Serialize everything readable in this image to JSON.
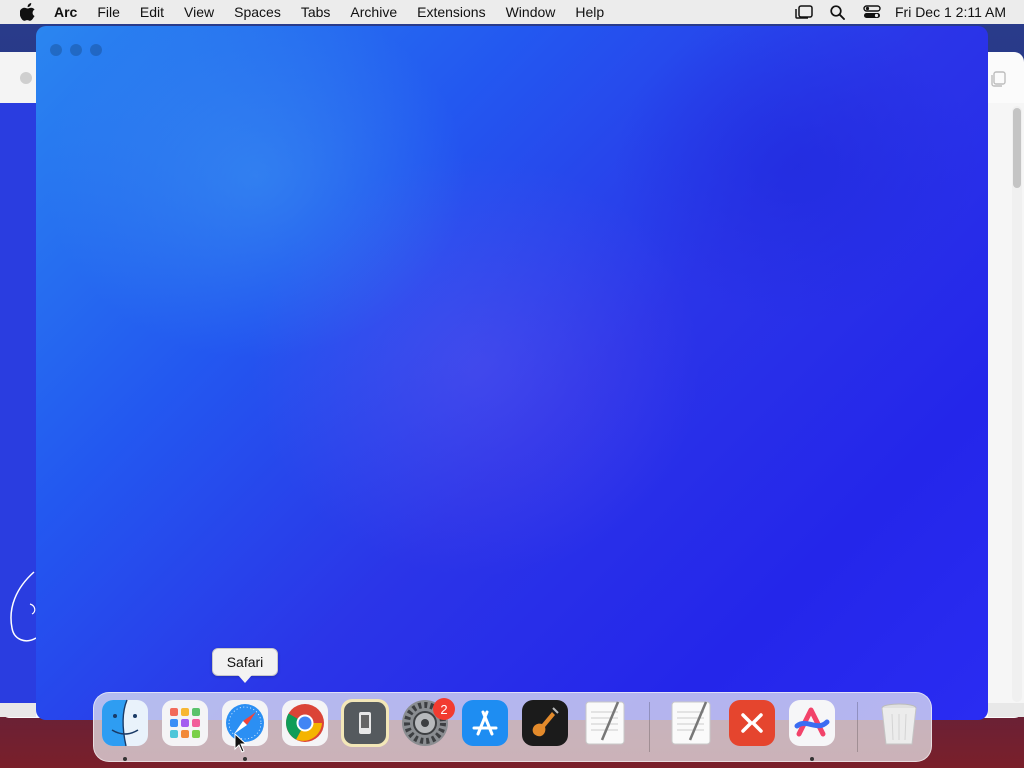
{
  "menubar": {
    "app_name": "Arc",
    "items": [
      "File",
      "Edit",
      "View",
      "Spaces",
      "Tabs",
      "Archive",
      "Extensions",
      "Window",
      "Help"
    ],
    "clock": "Fri Dec 1  2:11 AM",
    "status_icons": [
      "stage-manager-icon",
      "spotlight-search-icon",
      "control-center-icon"
    ]
  },
  "tooltip": {
    "label": "Safari"
  },
  "dock": {
    "items": [
      {
        "name": "Finder",
        "icon": "finder-icon",
        "running": true
      },
      {
        "name": "Launchpad",
        "icon": "launchpad-icon",
        "running": false
      },
      {
        "name": "Safari",
        "icon": "safari-icon",
        "running": true
      },
      {
        "name": "Google Chrome",
        "icon": "chrome-icon",
        "running": false
      },
      {
        "name": "Simulator",
        "icon": "simulator-icon",
        "running": false
      },
      {
        "name": "System Settings",
        "icon": "system-settings-icon",
        "running": false,
        "badge": "2"
      },
      {
        "name": "App Store",
        "icon": "app-store-icon",
        "running": false
      },
      {
        "name": "GarageBand",
        "icon": "garageband-icon",
        "running": false
      },
      {
        "name": "TextEdit",
        "icon": "textedit-icon",
        "running": false
      },
      {
        "name": "TextEdit Document",
        "icon": "textedit-doc-icon",
        "running": false
      },
      {
        "name": "Remote Desktop",
        "icon": "remote-desktop-icon",
        "running": false
      },
      {
        "name": "Arc",
        "icon": "arc-icon",
        "running": true
      },
      {
        "name": "Trash",
        "icon": "trash-icon",
        "running": false
      }
    ]
  },
  "colors": {
    "window_gradient_start": "#2a86f0",
    "window_gradient_end": "#2426ea",
    "badge": "#f23b30"
  }
}
